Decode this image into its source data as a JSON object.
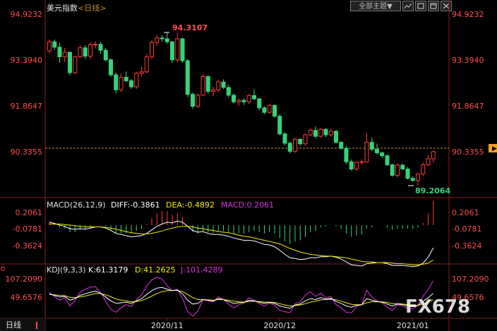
{
  "header": {
    "title": "美元指数",
    "period_open": "<",
    "period": "日线",
    "period_close": ">",
    "dropdown_label": "全部主题▼",
    "icons": [
      "chart-icon",
      "square-icon",
      "window-icon",
      "close-icon"
    ]
  },
  "colors": {
    "up": "#ff3b3b",
    "down": "#36d27a",
    "price_axis": "#ff4d4d",
    "diff": "#ffffff",
    "dea": "#f0f000",
    "macd": "#dd33dd",
    "k": "#ffffff",
    "d": "#f0f000",
    "j": "#dd33dd",
    "ref_line": "#d08a3a"
  },
  "main": {
    "price_labels": [
      "94.9232",
      "93.3940",
      "91.8647",
      "90.3355"
    ],
    "price_label_current": "90.3355",
    "high_marker": "94.3107",
    "low_marker": "89.2064"
  },
  "macd": {
    "title": "MACD(26,12,9)",
    "diff": "DIFF:-0.3861",
    "dea": "DEA:-0.4892",
    "macd": "MACD:0.2061",
    "labels": [
      "0.2061",
      "-0.0781",
      "-0.3624"
    ]
  },
  "kdj": {
    "title": "KDJ(9,3,3)",
    "k": "K:61.3179",
    "d": "D:41.2625",
    "j": "J:101.4289",
    "labels": [
      "107.2090",
      "49.6576"
    ]
  },
  "xaxis": {
    "period_tab": "日线",
    "dates": [
      "2020/11",
      "2020/12",
      "2021/01"
    ]
  },
  "watermark": "FX678",
  "chart_data": [
    {
      "type": "candlestick",
      "title": "美元指数",
      "series": [
        {
          "name": "",
          "ohlc": [
            [
              93.7,
              94.07,
              93.62,
              94.0
            ],
            [
              94.0,
              94.08,
              93.72,
              93.82
            ],
            [
              93.82,
              93.95,
              93.3,
              93.5
            ],
            [
              93.5,
              93.8,
              93.33,
              93.65
            ],
            [
              93.65,
              93.68,
              92.88,
              92.97
            ],
            [
              92.97,
              93.54,
              92.93,
              93.5
            ],
            [
              93.5,
              93.88,
              93.46,
              93.8
            ],
            [
              93.8,
              93.89,
              93.42,
              93.52
            ],
            [
              93.52,
              93.98,
              93.42,
              93.9
            ],
            [
              93.9,
              94.02,
              93.78,
              93.92
            ],
            [
              93.92,
              94.0,
              93.6,
              93.72
            ],
            [
              93.72,
              93.8,
              93.34,
              93.4
            ],
            [
              93.4,
              93.46,
              92.83,
              92.9
            ],
            [
              92.9,
              92.98,
              92.28,
              92.4
            ],
            [
              92.4,
              92.94,
              92.33,
              92.82
            ],
            [
              92.82,
              93.01,
              92.65,
              92.7
            ],
            [
              92.7,
              92.76,
              92.43,
              92.5
            ],
            [
              92.5,
              93.01,
              92.43,
              92.95
            ],
            [
              92.95,
              93.17,
              92.86,
              93.0
            ],
            [
              93.0,
              93.6,
              92.95,
              93.5
            ],
            [
              93.5,
              94.05,
              93.43,
              93.98
            ],
            [
              93.98,
              94.22,
              93.86,
              94.13
            ],
            [
              94.13,
              94.22,
              94.0,
              94.1
            ],
            [
              94.1,
              94.31,
              93.92,
              94.0
            ],
            [
              94.0,
              94.03,
              93.3,
              93.4
            ],
            [
              93.4,
              94.31,
              93.32,
              94.1
            ],
            [
              94.1,
              94.13,
              93.3,
              93.37
            ],
            [
              93.37,
              93.43,
              92.16,
              92.25
            ],
            [
              92.25,
              92.31,
              91.77,
              91.85
            ],
            [
              91.85,
              92.28,
              91.8,
              92.22
            ],
            [
              92.22,
              92.93,
              92.2,
              92.84
            ],
            [
              92.84,
              92.89,
              92.28,
              92.35
            ],
            [
              92.35,
              92.5,
              92.18,
              92.4
            ],
            [
              92.4,
              92.73,
              92.33,
              92.66
            ],
            [
              92.66,
              92.75,
              92.42,
              92.48
            ],
            [
              92.48,
              92.57,
              92.15,
              92.22
            ],
            [
              92.22,
              92.28,
              91.95,
              92.0
            ],
            [
              92.0,
              92.11,
              91.86,
              92.05
            ],
            [
              92.05,
              92.12,
              91.9,
              92.0
            ],
            [
              92.0,
              92.27,
              91.92,
              92.21
            ],
            [
              92.21,
              92.42,
              92.06,
              92.1
            ],
            [
              92.1,
              92.12,
              91.72,
              91.8
            ],
            [
              91.8,
              91.85,
              91.58,
              91.65
            ],
            [
              91.65,
              91.93,
              91.6,
              91.88
            ],
            [
              91.88,
              91.92,
              91.47,
              91.52
            ],
            [
              91.52,
              91.58,
              90.88,
              90.93
            ],
            [
              90.93,
              90.98,
              90.55,
              90.62
            ],
            [
              90.62,
              90.68,
              90.27,
              90.35
            ],
            [
              90.35,
              90.8,
              90.3,
              90.75
            ],
            [
              90.75,
              90.79,
              90.54,
              90.6
            ],
            [
              90.6,
              90.94,
              90.55,
              90.9
            ],
            [
              90.9,
              91.11,
              90.85,
              91.05
            ],
            [
              91.05,
              91.18,
              90.78,
              90.85
            ],
            [
              90.85,
              91.13,
              90.8,
              91.08
            ],
            [
              91.08,
              91.12,
              90.82,
              90.9
            ],
            [
              90.9,
              91.09,
              90.85,
              91.02
            ],
            [
              91.02,
              91.06,
              90.6,
              90.65
            ],
            [
              90.65,
              90.69,
              90.4,
              90.45
            ],
            [
              90.45,
              90.52,
              89.93,
              90.0
            ],
            [
              90.0,
              90.08,
              89.7,
              89.76
            ],
            [
              89.76,
              90.02,
              89.7,
              89.98
            ],
            [
              89.98,
              90.08,
              89.9,
              90.0
            ],
            [
              90.0,
              90.96,
              89.97,
              90.65
            ],
            [
              90.65,
              90.82,
              90.35,
              90.42
            ],
            [
              90.42,
              90.61,
              90.24,
              90.3
            ],
            [
              90.3,
              90.35,
              90.12,
              90.2
            ],
            [
              90.2,
              90.24,
              89.86,
              89.9
            ],
            [
              89.9,
              89.94,
              89.5,
              89.55
            ],
            [
              89.55,
              89.94,
              89.47,
              89.89
            ],
            [
              89.89,
              89.94,
              89.72,
              89.76
            ],
            [
              89.76,
              89.82,
              89.41,
              89.45
            ],
            [
              89.45,
              89.52,
              89.32,
              89.38
            ],
            [
              89.38,
              89.43,
              89.21,
              89.6
            ],
            [
              89.6,
              89.98,
              89.52,
              89.9
            ],
            [
              89.9,
              90.22,
              89.86,
              90.1
            ],
            [
              90.1,
              90.38,
              89.98,
              90.34
            ]
          ]
        }
      ],
      "reference_value": 90.3355,
      "high_label": 94.3107,
      "low_label": 89.2064,
      "y_ticks": [
        94.9232,
        93.394,
        91.8647,
        90.3355
      ],
      "x_tick_labels": [
        "2020/11",
        "2020/12",
        "2021/01"
      ],
      "x_tick_index": [
        23,
        45,
        71
      ]
    },
    {
      "type": "line",
      "title": "MACD(26,12,9)",
      "series": [
        {
          "name": "DIFF",
          "values": [
            0.05,
            0.03,
            0.0,
            -0.02,
            -0.06,
            -0.07,
            -0.06,
            -0.07,
            -0.05,
            -0.03,
            -0.03,
            -0.05,
            -0.09,
            -0.14,
            -0.16,
            -0.18,
            -0.2,
            -0.19,
            -0.18,
            -0.14,
            -0.08,
            -0.02,
            0.02,
            0.05,
            0.04,
            0.07,
            0.05,
            -0.02,
            -0.09,
            -0.12,
            -0.11,
            -0.14,
            -0.16,
            -0.16,
            -0.17,
            -0.19,
            -0.22,
            -0.24,
            -0.26,
            -0.26,
            -0.27,
            -0.3,
            -0.33,
            -0.34,
            -0.37,
            -0.43,
            -0.5,
            -0.56,
            -0.57,
            -0.59,
            -0.58,
            -0.56,
            -0.56,
            -0.54,
            -0.54,
            -0.53,
            -0.55,
            -0.58,
            -0.63,
            -0.68,
            -0.69,
            -0.7,
            -0.66,
            -0.65,
            -0.64,
            -0.64,
            -0.66,
            -0.69,
            -0.69,
            -0.69,
            -0.7,
            -0.71,
            -0.7,
            -0.65,
            -0.55,
            -0.39
          ]
        },
        {
          "name": "DEA",
          "values": [
            0.02,
            0.02,
            0.02,
            0.01,
            0.0,
            -0.01,
            -0.02,
            -0.03,
            -0.03,
            -0.03,
            -0.03,
            -0.04,
            -0.05,
            -0.07,
            -0.09,
            -0.11,
            -0.13,
            -0.14,
            -0.15,
            -0.15,
            -0.14,
            -0.12,
            -0.1,
            -0.07,
            -0.05,
            -0.03,
            -0.02,
            -0.02,
            -0.03,
            -0.05,
            -0.06,
            -0.08,
            -0.09,
            -0.11,
            -0.12,
            -0.13,
            -0.15,
            -0.17,
            -0.19,
            -0.2,
            -0.22,
            -0.24,
            -0.26,
            -0.28,
            -0.3,
            -0.32,
            -0.36,
            -0.4,
            -0.43,
            -0.46,
            -0.48,
            -0.5,
            -0.51,
            -0.52,
            -0.53,
            -0.53,
            -0.54,
            -0.55,
            -0.56,
            -0.58,
            -0.6,
            -0.62,
            -0.63,
            -0.63,
            -0.64,
            -0.64,
            -0.64,
            -0.65,
            -0.66,
            -0.66,
            -0.67,
            -0.68,
            -0.68,
            -0.67,
            -0.65,
            -0.6
          ]
        },
        {
          "name": "MACD",
          "values": [
            0.06,
            0.02,
            -0.04,
            -0.06,
            -0.12,
            -0.12,
            -0.08,
            -0.08,
            -0.04,
            0.0,
            0.0,
            -0.02,
            -0.08,
            -0.14,
            -0.14,
            -0.14,
            -0.14,
            -0.1,
            -0.06,
            0.02,
            0.12,
            0.2,
            0.24,
            0.24,
            0.18,
            0.2,
            0.14,
            0.0,
            -0.12,
            -0.14,
            -0.1,
            -0.12,
            -0.14,
            -0.1,
            -0.1,
            -0.12,
            -0.14,
            -0.14,
            -0.14,
            -0.12,
            -0.1,
            -0.12,
            -0.14,
            -0.12,
            -0.14,
            -0.22,
            -0.28,
            -0.32,
            -0.28,
            -0.26,
            -0.2,
            -0.12,
            -0.1,
            -0.04,
            -0.02,
            0.0,
            -0.02,
            -0.06,
            -0.14,
            -0.2,
            -0.18,
            -0.16,
            -0.06,
            -0.04,
            0.0,
            0.0,
            -0.04,
            -0.08,
            -0.06,
            -0.06,
            -0.06,
            -0.06,
            -0.04,
            0.04,
            0.2,
            0.42
          ]
        }
      ],
      "y_ticks": [
        0.2061,
        -0.0781,
        -0.3624
      ]
    },
    {
      "type": "line",
      "title": "KDJ(9,3,3)",
      "series": [
        {
          "name": "K",
          "values": [
            60,
            55,
            50,
            52,
            40,
            45,
            55,
            60,
            65,
            68,
            62,
            50,
            38,
            30,
            32,
            34,
            30,
            38,
            45,
            58,
            70,
            78,
            80,
            75,
            70,
            72,
            60,
            40,
            28,
            30,
            42,
            40,
            38,
            45,
            42,
            36,
            30,
            32,
            33,
            40,
            38,
            34,
            30,
            33,
            30,
            22,
            18,
            15,
            25,
            28,
            38,
            45,
            42,
            48,
            44,
            46,
            36,
            30,
            22,
            18,
            24,
            26,
            45,
            40,
            36,
            34,
            28,
            22,
            28,
            26,
            22,
            20,
            24,
            36,
            48,
            61.3
          ]
        },
        {
          "name": "D",
          "values": [
            58,
            57,
            55,
            54,
            49,
            48,
            50,
            53,
            57,
            61,
            61,
            57,
            51,
            44,
            40,
            38,
            35,
            36,
            39,
            45,
            53,
            61,
            67,
            70,
            70,
            71,
            67,
            58,
            48,
            42,
            42,
            41,
            40,
            42,
            42,
            40,
            37,
            35,
            34,
            36,
            37,
            36,
            34,
            34,
            33,
            29,
            25,
            22,
            23,
            25,
            29,
            34,
            37,
            41,
            42,
            43,
            41,
            37,
            32,
            27,
            26,
            26,
            32,
            35,
            35,
            35,
            33,
            29,
            29,
            28,
            26,
            24,
            24,
            28,
            35,
            41.3
          ]
        },
        {
          "name": "J",
          "values": [
            64,
            51,
            40,
            48,
            22,
            39,
            65,
            74,
            81,
            82,
            64,
            36,
            12,
            2,
            16,
            26,
            20,
            42,
            57,
            84,
            104,
            112,
            106,
            85,
            70,
            74,
            46,
            4,
            -12,
            6,
            42,
            38,
            34,
            51,
            42,
            28,
            16,
            26,
            31,
            48,
            40,
            30,
            22,
            31,
            24,
            8,
            4,
            1,
            29,
            34,
            56,
            67,
            52,
            62,
            48,
            52,
            26,
            16,
            2,
            0,
            20,
            26,
            71,
            50,
            38,
            32,
            18,
            8,
            26,
            22,
            14,
            12,
            24,
            52,
            74,
            101.4
          ]
        }
      ],
      "y_ticks": [
        107.209,
        49.6576
      ]
    }
  ]
}
